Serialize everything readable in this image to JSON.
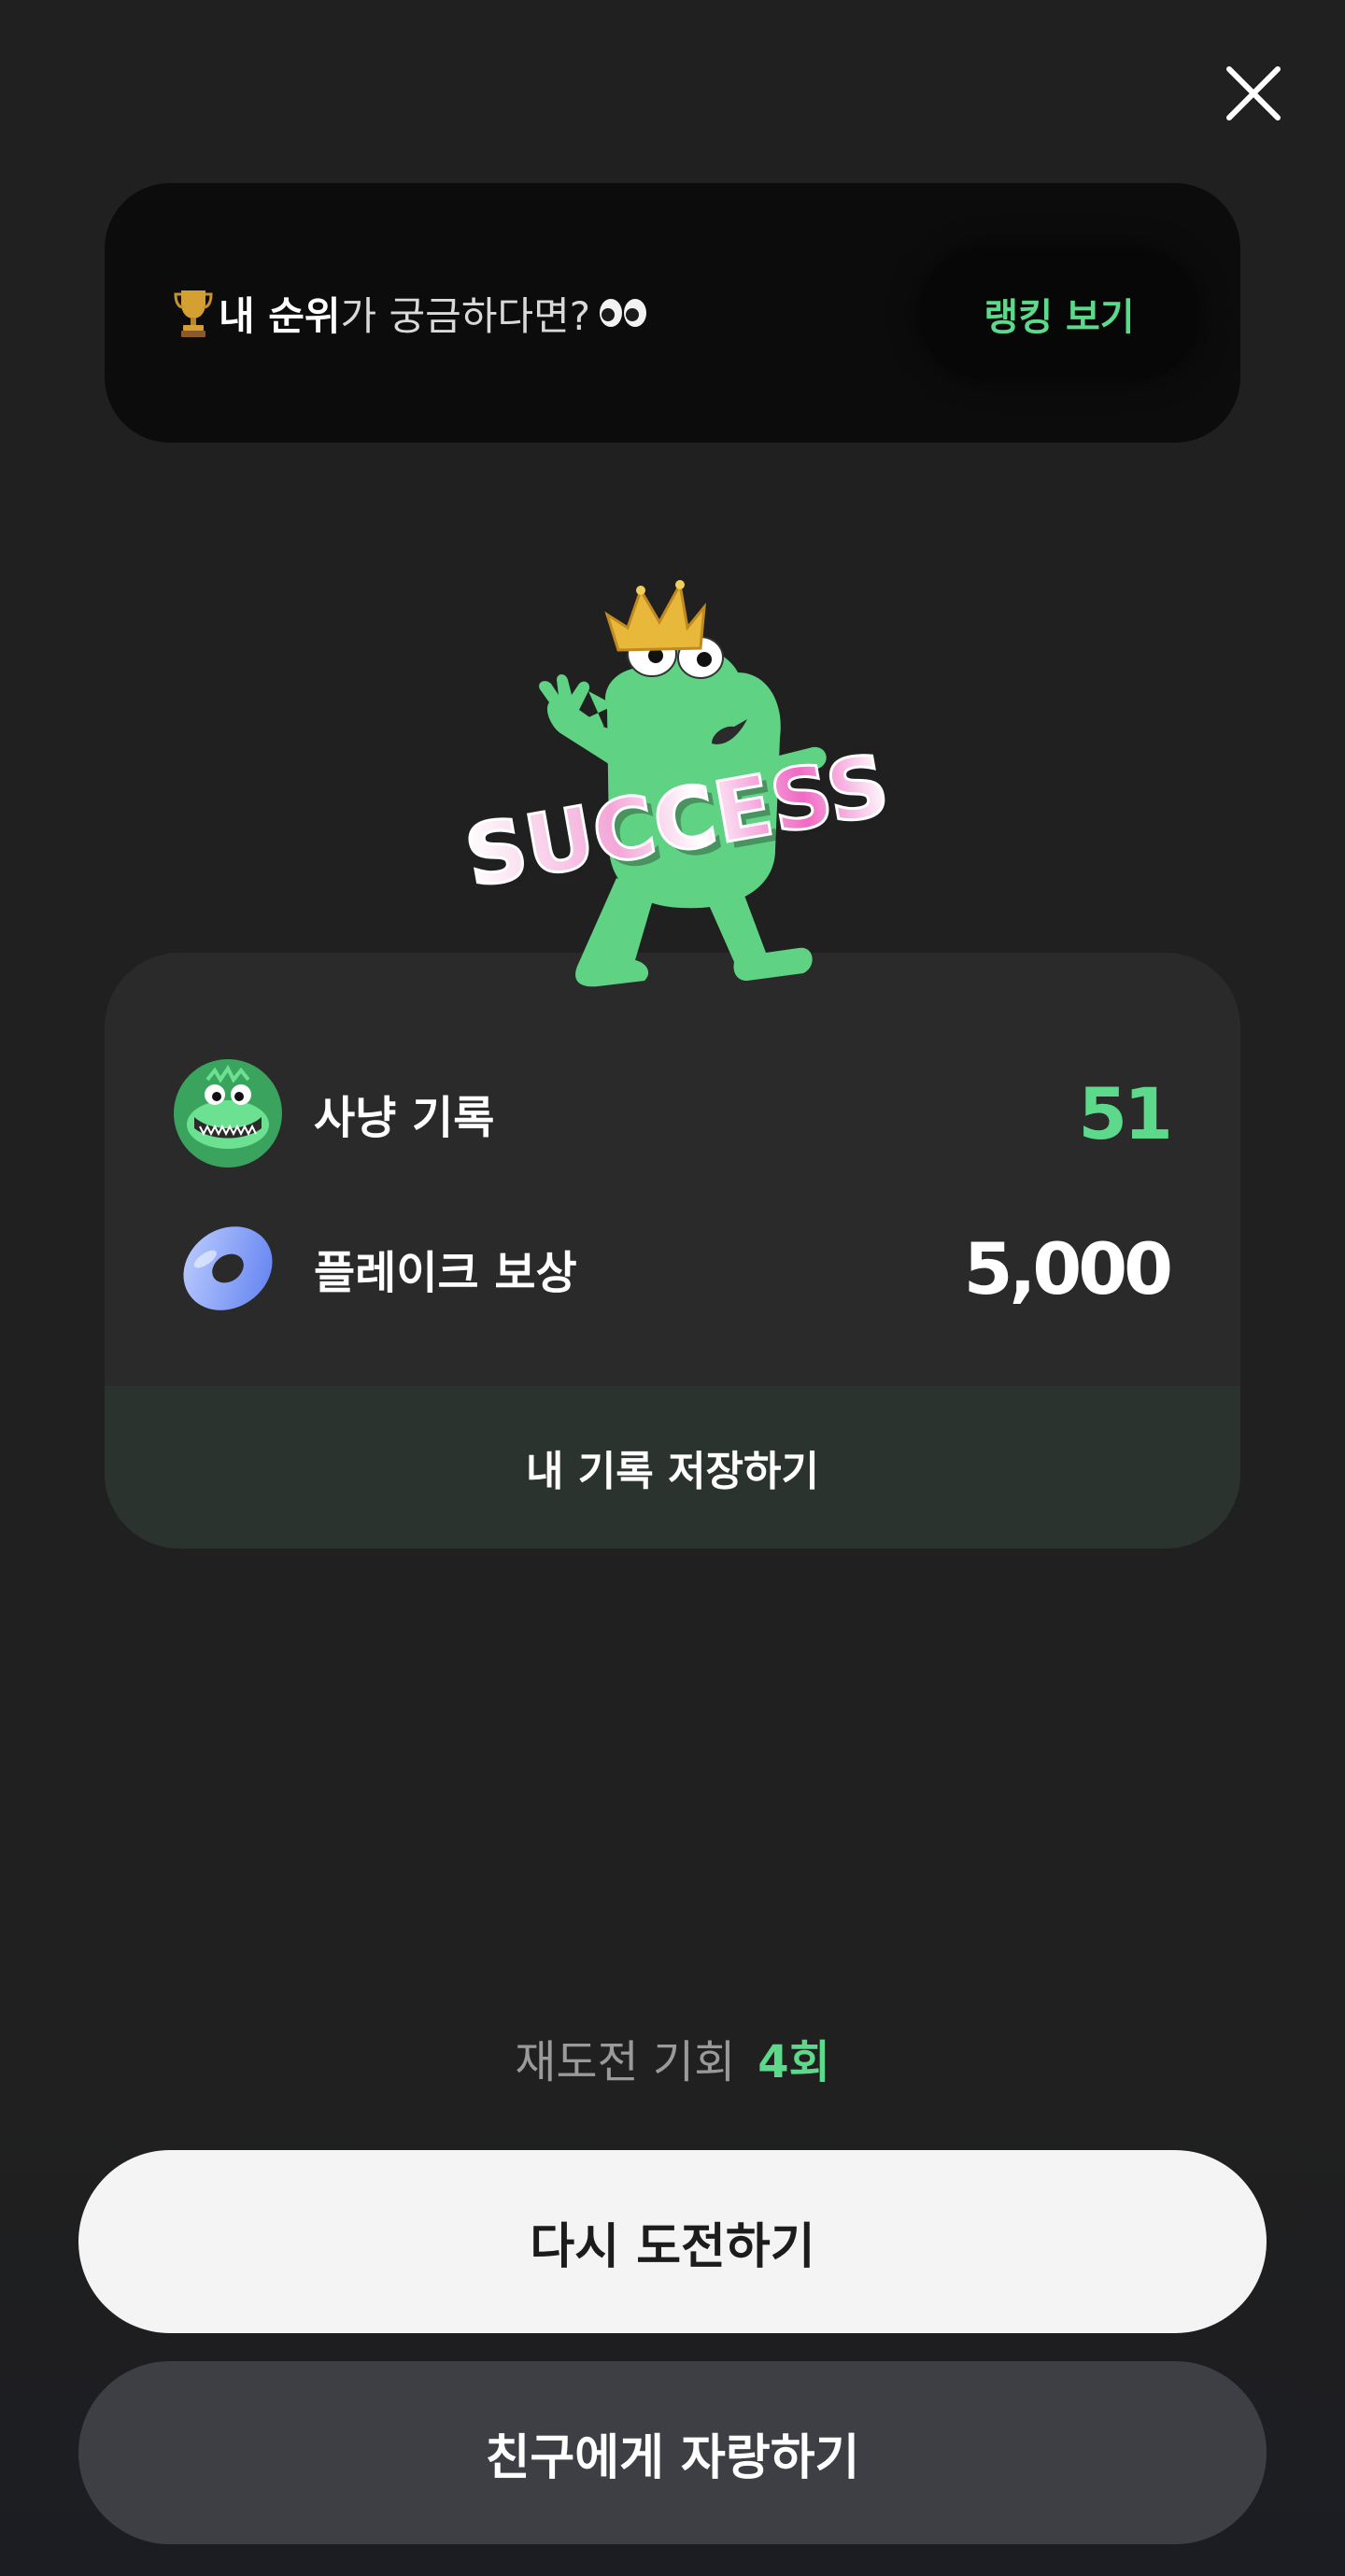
{
  "header": {
    "close_icon": "close-icon"
  },
  "ranking_banner": {
    "emoji_left": "🏆",
    "strong_text": "내 순위",
    "rest_text": "가 궁금하다면?",
    "emoji_right": "👀",
    "button_label": "랭킹 보기"
  },
  "hero": {
    "mascot_icon": "crowned-green-dino-mascot",
    "badge_text": "SUCCESS"
  },
  "result_card": {
    "rows": [
      {
        "icon": "dino-avatar-icon",
        "label": "사냥 기록",
        "value": "51"
      },
      {
        "icon": "blue-donut-icon",
        "label": "플레이크 보상",
        "value": "5,000"
      }
    ],
    "save_button_label": "내 기록 저장하기"
  },
  "retry": {
    "label": "재도전 기회",
    "count": "4회"
  },
  "actions": {
    "retry_button_label": "다시 도전하기",
    "share_button_label": "친구에게 자랑하기"
  },
  "colors": {
    "background": "#202020",
    "accent_green": "#5cd98a",
    "card": "#2a2a2a",
    "banner": "#0c0c0c"
  }
}
